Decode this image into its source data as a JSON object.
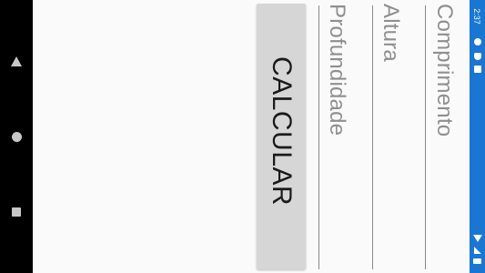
{
  "status_bar": {
    "time": "2:37",
    "color": "#1976d2",
    "icons": [
      "gear-icon",
      "shield-icon",
      "sim-icon",
      "wifi-icon",
      "signal-icon",
      "battery-icon"
    ]
  },
  "nav_bar": {
    "buttons": [
      "back-icon",
      "home-icon",
      "recents-icon"
    ]
  },
  "form": {
    "comprimento_placeholder": "Comprimento",
    "altura_placeholder": "Altura",
    "profundidade_placeholder": "Profundidade",
    "calculate_label": "CALCULAR"
  }
}
